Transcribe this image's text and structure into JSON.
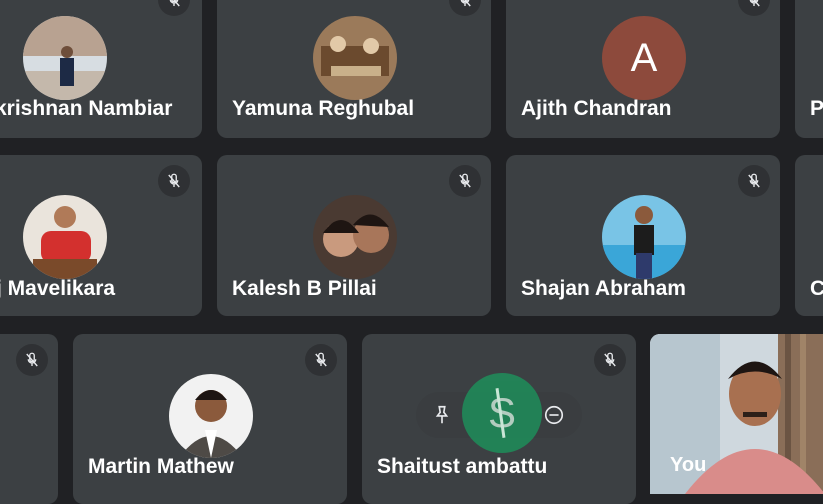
{
  "participants": [
    {
      "name": "krishnan Nambiar"
    },
    {
      "name": "Yamuna Reghubal"
    },
    {
      "name": "Ajith Chandran",
      "avatar_letter": "A",
      "avatar_color": "#8d4a3c"
    },
    {
      "name": "P"
    },
    {
      "name": "j Mavelikara"
    },
    {
      "name": "Kalesh B Pillai"
    },
    {
      "name": "Shajan Abraham"
    },
    {
      "name": "C"
    },
    {
      "name": "Martin Mathew"
    },
    {
      "name": "Shaitust ambattu",
      "avatar_letter": "S"
    },
    {
      "name": "You"
    }
  ],
  "controls": {
    "pin_icon": "pin-icon",
    "mute_icon": "mic-off-icon",
    "remove_icon": "remove-icon"
  },
  "colors": {
    "background": "#202124",
    "tile": "#3c4043",
    "speaking": "#1e8e5a"
  }
}
